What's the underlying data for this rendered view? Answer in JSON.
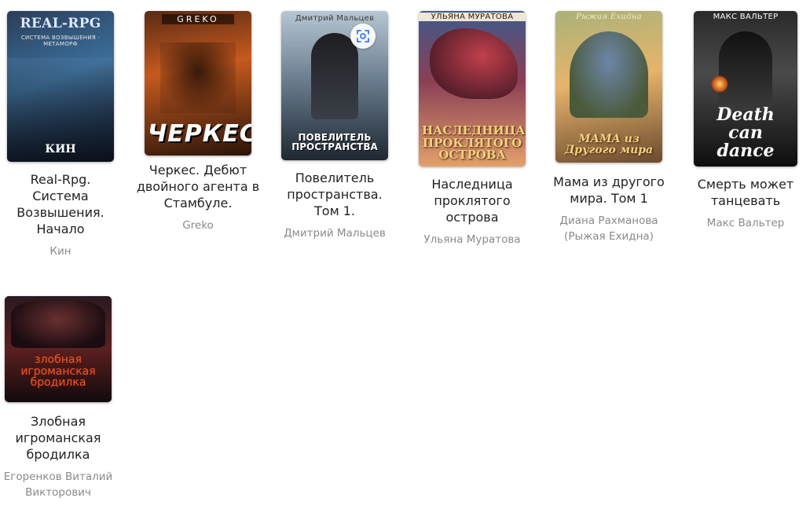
{
  "books": [
    {
      "title": "Real-Rpg. Система Возвышения. Начало",
      "author": "Кин",
      "cover_top": "REAL-RPG",
      "cover_sub": "СИСТЕМА ВОЗВЫШЕНИЯ · МЕТАМОРФ",
      "cover_main": "КИН",
      "colors": [
        "#1c2a3f",
        "#3a6f9a",
        "#0e1622"
      ]
    },
    {
      "title": "Черкес. Дебют двойного агента в Стамбуле.",
      "author": "Greko",
      "cover_top": "GREKO",
      "cover_main": "ЧЕРКЕС",
      "colors": [
        "#3b1a10",
        "#b3521d",
        "#201008"
      ]
    },
    {
      "title": "Повелитель пространства. Том 1.",
      "author": "Дмитрий Мальцев",
      "cover_top": "Дмитрий Мальцев",
      "cover_main": "ПОВЕЛИТЕЛЬ ПРОСТРАНСТВА",
      "colors": [
        "#5e7a94",
        "#c9d3da",
        "#1e2a35"
      ]
    },
    {
      "title": "Наследница проклятого острова",
      "author": "Ульяна Муратова",
      "cover_top": "УЛЬЯНА МУРАТОВА",
      "cover_main": "НАСЛЕДНИЦА ПРОКЛЯТОГО ОСТРОВА",
      "colors": [
        "#2b3f6c",
        "#b0434b",
        "#e6a069"
      ]
    },
    {
      "title": "Мама из другого мира. Том 1",
      "author": "Диана Рахманова (Рыжая Ехидна)",
      "cover_top": "Рыжая Ехидна",
      "cover_main": "МАМА из Другого мира",
      "colors": [
        "#7c8a5a",
        "#e7b46a",
        "#5a3f2b"
      ]
    },
    {
      "title": "Смерть может танцевать",
      "author": "Макс Вальтер",
      "cover_top": "МАКС ВАЛЬТЕР",
      "cover_main": "Death can dance",
      "colors": [
        "#1a1a1a",
        "#5a5a5a",
        "#0b0b0b"
      ]
    },
    {
      "title": "Злобная игроманская бродилка",
      "author": "Егоренков Виталий Викторович",
      "cover_main": "злобная игроманская бродилка",
      "colors": [
        "#2b1a22",
        "#8a2a2a",
        "#150c10"
      ]
    }
  ],
  "ui": {
    "lens_icon": "visual-search-icon"
  }
}
